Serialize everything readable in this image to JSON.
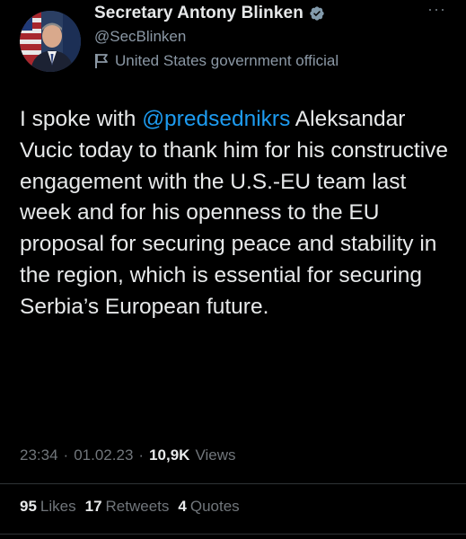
{
  "author": {
    "display_name": "Secretary Antony Blinken",
    "handle": "@SecBlinken",
    "label": "United States government official",
    "verified_badge_color": "#829aab"
  },
  "icons": {
    "verified": "verified-badge-icon",
    "label": "flag-icon",
    "more": "more-options-icon"
  },
  "tweet": {
    "mention": "@predsednikrs",
    "text_before_mention": "I spoke with ",
    "text_after_mention": " Aleksandar Vucic today to thank him for his constructive engagement with the U.S.-EU team last week and for his openness to the EU proposal for securing peace and stability in the region, which is essential for securing Serbia’s European future."
  },
  "meta": {
    "time": "23:34",
    "separator": "·",
    "date": "01.02.23",
    "views_count": "10,9K",
    "views_label": "Views"
  },
  "stats": {
    "likes_count": "95",
    "likes_label": "Likes",
    "retweets_count": "17",
    "retweets_label": "Retweets",
    "quotes_count": "4",
    "quotes_label": "Quotes"
  },
  "colors": {
    "background": "#000000",
    "text": "#e7e9ea",
    "secondary": "#71767b",
    "link": "#1d9bf0"
  }
}
